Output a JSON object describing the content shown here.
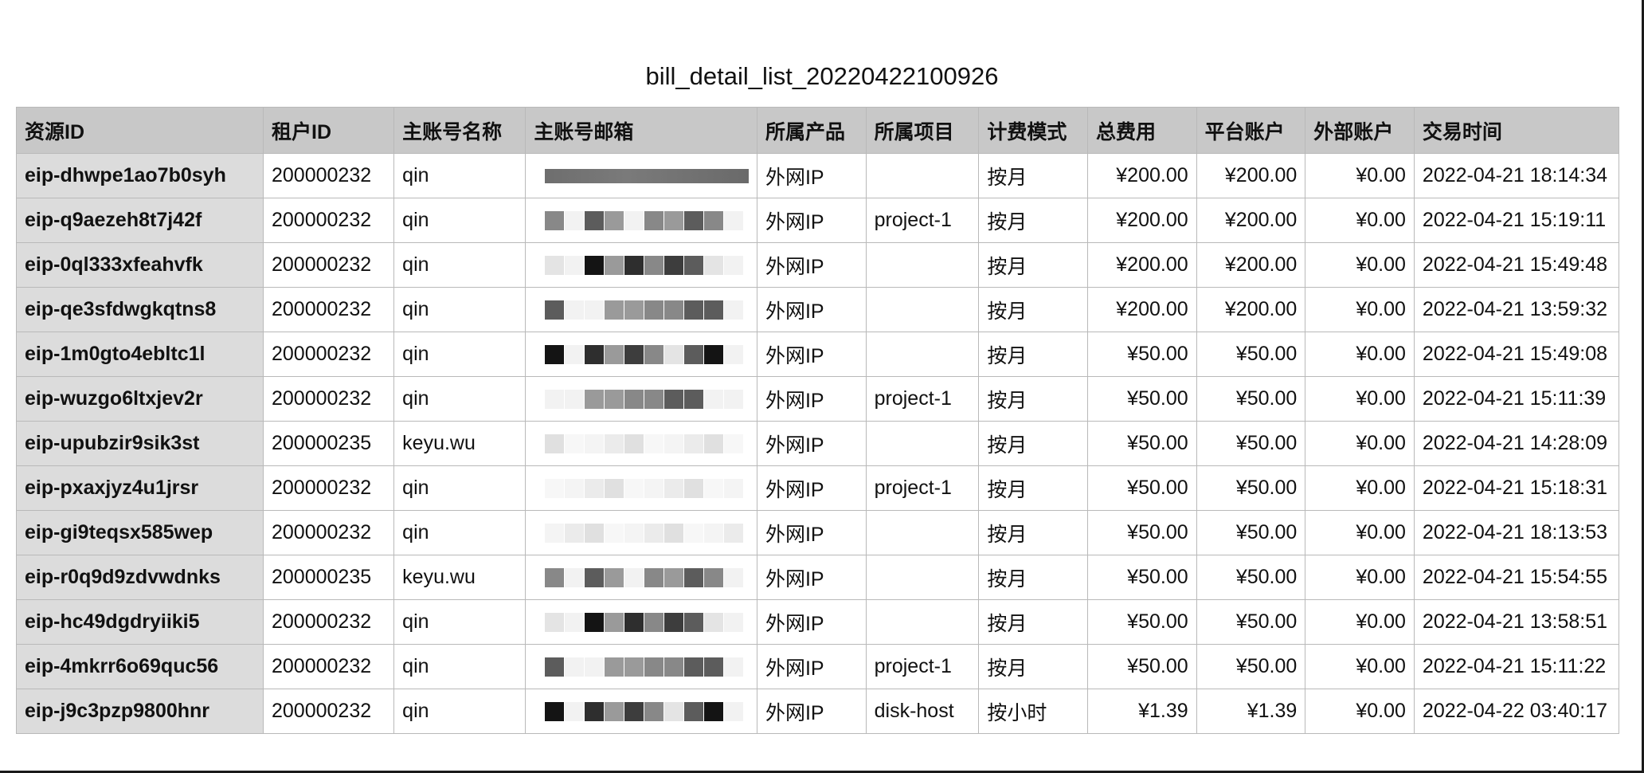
{
  "document": {
    "title": "bill_detail_list_20220422100926"
  },
  "table": {
    "headers": [
      "资源ID",
      "租户ID",
      "主账号名称",
      "主账号邮箱",
      "所属产品",
      "所属项目",
      "计费模式",
      "总费用",
      "平台账户",
      "外部账户",
      "交易时间"
    ],
    "rows": [
      [
        "eip-dhwpe1ao7b0syh",
        "200000232",
        "qin",
        "",
        "外网IP",
        "",
        "按月",
        "¥200.00",
        "¥200.00",
        "¥0.00",
        "2022-04-21 18:14:34"
      ],
      [
        "eip-q9aezeh8t7j42f",
        "200000232",
        "qin",
        "",
        "外网IP",
        "project-1",
        "按月",
        "¥200.00",
        "¥200.00",
        "¥0.00",
        "2022-04-21 15:19:11"
      ],
      [
        "eip-0ql333xfeahvfk",
        "200000232",
        "qin",
        "",
        "外网IP",
        "",
        "按月",
        "¥200.00",
        "¥200.00",
        "¥0.00",
        "2022-04-21 15:49:48"
      ],
      [
        "eip-qe3sfdwgkqtns8",
        "200000232",
        "qin",
        "",
        "外网IP",
        "",
        "按月",
        "¥200.00",
        "¥200.00",
        "¥0.00",
        "2022-04-21 13:59:32"
      ],
      [
        "eip-1m0gto4ebltc1l",
        "200000232",
        "qin",
        "",
        "外网IP",
        "",
        "按月",
        "¥50.00",
        "¥50.00",
        "¥0.00",
        "2022-04-21 15:49:08"
      ],
      [
        "eip-wuzgo6ltxjev2r",
        "200000232",
        "qin",
        "",
        "外网IP",
        "project-1",
        "按月",
        "¥50.00",
        "¥50.00",
        "¥0.00",
        "2022-04-21 15:11:39"
      ],
      [
        "eip-upubzir9sik3st",
        "200000235",
        "keyu.wu",
        "",
        "外网IP",
        "",
        "按月",
        "¥50.00",
        "¥50.00",
        "¥0.00",
        "2022-04-21 14:28:09"
      ],
      [
        "eip-pxaxjyz4u1jrsr",
        "200000232",
        "qin",
        "",
        "外网IP",
        "project-1",
        "按月",
        "¥50.00",
        "¥50.00",
        "¥0.00",
        "2022-04-21 15:18:31"
      ],
      [
        "eip-gi9teqsx585wep",
        "200000232",
        "qin",
        "",
        "外网IP",
        "",
        "按月",
        "¥50.00",
        "¥50.00",
        "¥0.00",
        "2022-04-21 18:13:53"
      ],
      [
        "eip-r0q9d9zdvwdnks",
        "200000235",
        "keyu.wu",
        "",
        "外网IP",
        "",
        "按月",
        "¥50.00",
        "¥50.00",
        "¥0.00",
        "2022-04-21 15:54:55"
      ],
      [
        "eip-hc49dgdryiiki5",
        "200000232",
        "qin",
        "",
        "外网IP",
        "",
        "按月",
        "¥50.00",
        "¥50.00",
        "¥0.00",
        "2022-04-21 13:58:51"
      ],
      [
        "eip-4mkrr6o69quc56",
        "200000232",
        "qin",
        "",
        "外网IP",
        "project-1",
        "按月",
        "¥50.00",
        "¥50.00",
        "¥0.00",
        "2022-04-21 15:11:22"
      ],
      [
        "eip-j9c3pzp9800hnr",
        "200000232",
        "qin",
        "",
        "外网IP",
        "disk-host",
        "按小时",
        "¥1.39",
        "¥1.39",
        "¥0.00",
        "2022-04-22 03:40:17"
      ]
    ]
  },
  "colors": {
    "header_bg": "#c8c8c8",
    "first_column_bg": "#dcdcdc",
    "grid_line": "#b9b9b9",
    "redaction_dark": "#3a3a3a",
    "redaction_light": "#e6e6e6"
  }
}
